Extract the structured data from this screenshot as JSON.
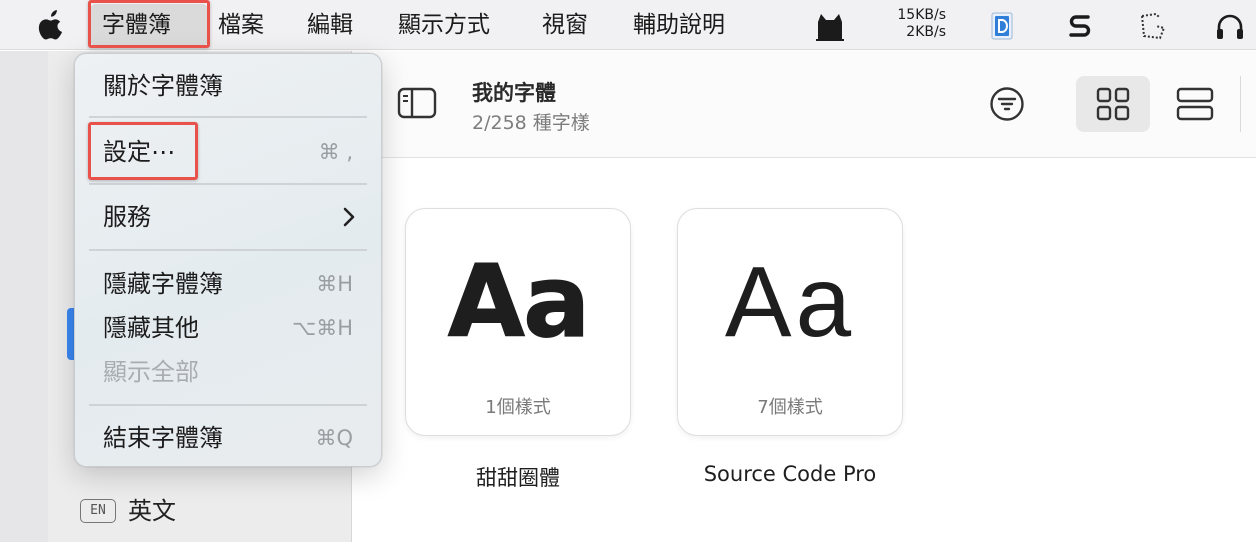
{
  "menubar": {
    "items": [
      "字體簿",
      "檔案",
      "編輯",
      "顯示方式",
      "視窗",
      "輔助說明"
    ],
    "net_up": "15KB/s",
    "net_down": "2KB/s",
    "tray_icons": [
      "cat-icon",
      "dict-app-icon",
      "scrivener-s-icon",
      "screenshot-dotted-icon",
      "headphones-icon"
    ]
  },
  "app_menu": {
    "about": "關於字體簿",
    "settings": "設定⋯",
    "settings_shortcut": "⌘ ,",
    "services": "服務",
    "hide": "隱藏字體簿",
    "hide_shortcut": "⌘H",
    "hide_others": "隱藏其他",
    "hide_others_shortcut": "⌥⌘H",
    "show_all": "顯示全部",
    "quit": "結束字體簿",
    "quit_shortcut": "⌘Q"
  },
  "toolbar": {
    "title": "我的字體",
    "subtitle": "2/258 種字樣"
  },
  "sidebar": {
    "lang_badge": "EN",
    "lang_label": "英文"
  },
  "fonts": [
    {
      "sample": "Aa",
      "count": "1個樣式",
      "name": "甜甜圈體"
    },
    {
      "sample": "Aa",
      "count": "7個樣式",
      "name": "Source Code Pro"
    }
  ],
  "colors": {
    "highlight": "#e8524a",
    "accent": "#3a86f2"
  }
}
